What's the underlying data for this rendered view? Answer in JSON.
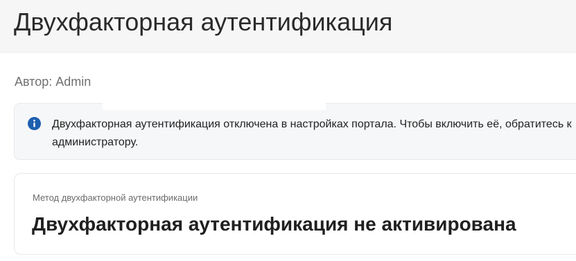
{
  "header": {
    "title": "Двухфакторная аутентификация"
  },
  "author": {
    "text": "Автор: Admin"
  },
  "notice": {
    "icon": "info-icon",
    "icon_color": "#1d5fae",
    "text": "Двухфакторная аутентификация отключена в настройках портала. Чтобы включить её, обратитесь к администратору."
  },
  "method": {
    "label": "Метод двухфакторной аутентификации",
    "value": "Двухфакторная аутентификация не активирована"
  }
}
